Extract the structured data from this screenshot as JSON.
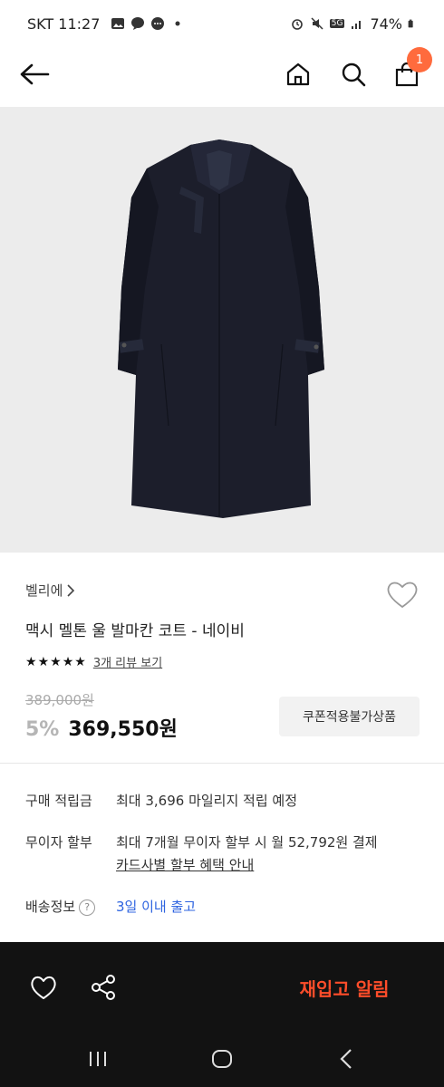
{
  "status": {
    "carrier_time": "SKT 11:27",
    "battery": "74%",
    "network": "5G"
  },
  "header": {
    "cart_count": "1",
    "icons": [
      "back-arrow-icon",
      "home-icon",
      "search-icon",
      "shopping-bag-icon"
    ]
  },
  "product": {
    "brand": "벨리에",
    "name": "맥시 멜톤 울 발마칸 코트 - 네이비",
    "rating_stars": 5,
    "review_link": "3개 리뷰 보기",
    "original_price": "389,000원",
    "discount": "5%",
    "price": "369,550원",
    "coupon_label": "쿠폰적용불가상품",
    "image_color": "#1c1e2b"
  },
  "info": {
    "points_label": "구매 적립금",
    "points_value": "최대 3,696 마일리지 적립 예정",
    "installment_label": "무이자 할부",
    "installment_value": "최대 7개월 무이자 할부 시 월 52,792원 결제",
    "installment_link": "카드사별 할부 혜택 안내",
    "delivery_label": "배송정보",
    "delivery_help": "?",
    "delivery_value": "3일 이내 출고"
  },
  "action_bar": {
    "restock_label": "재입고 알림",
    "accent_color": "#ff4d2a"
  },
  "colors": {
    "badge": "#ff6b3d",
    "delivery_link": "#2d63e0"
  }
}
